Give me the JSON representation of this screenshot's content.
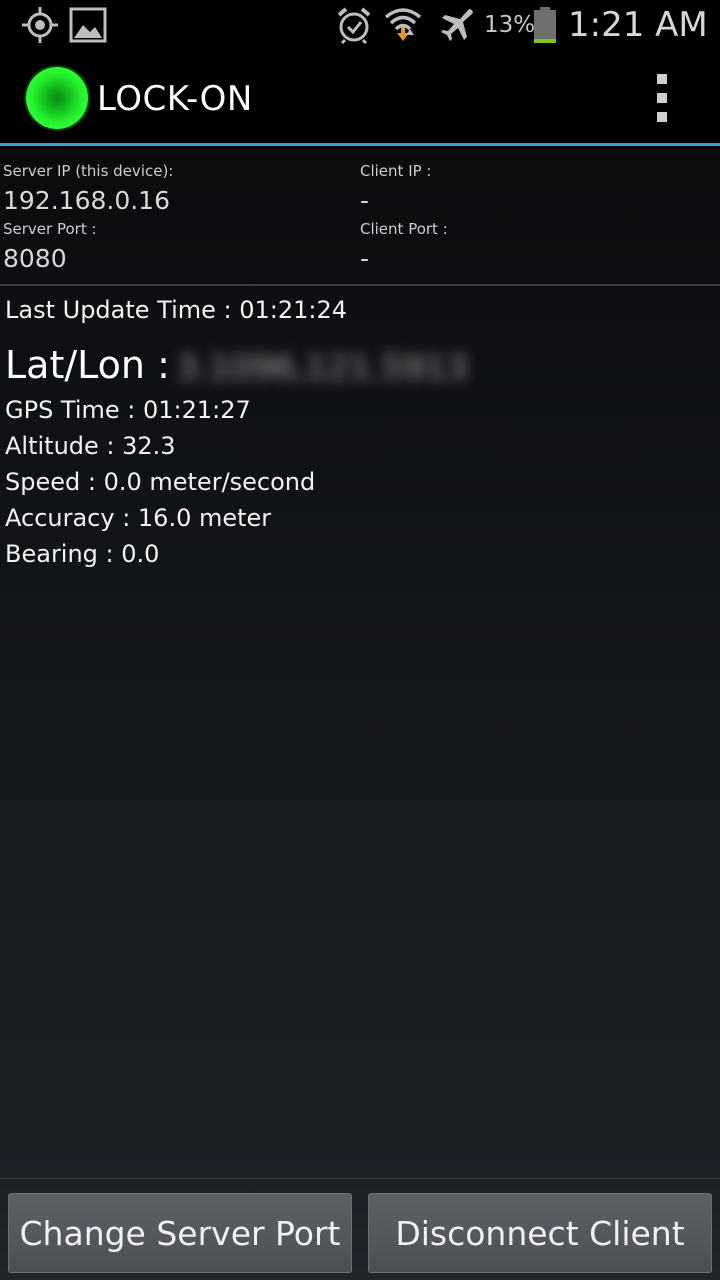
{
  "status_bar": {
    "icons": {
      "gps": "gps-icon",
      "image": "image-icon",
      "alarm": "alarm-icon",
      "wifi": "wifi-icon",
      "airplane": "airplane-icon",
      "battery": "battery-icon"
    },
    "battery_percent": "13%",
    "battery_level": 0.13,
    "time": "1:21 AM"
  },
  "action_bar": {
    "title": "LOCK-ON",
    "logo": "green-orb-logo",
    "menu_icon": "overflow-menu-icon"
  },
  "connection": {
    "server_ip_label": "Server IP (this device):",
    "server_ip": "192.168.0.16",
    "server_port_label": "Server Port :",
    "server_port": "8080",
    "client_ip_label": "Client IP :",
    "client_ip": "-",
    "client_port_label": "Client Port :",
    "client_port": "-"
  },
  "details": {
    "last_update": "Last Update Time : 01:21:24",
    "latlon_label": "Lat/Lon :",
    "latlon_value": "3.1096,121.5913",
    "gps_time": "GPS Time : 01:21:27",
    "altitude": "Altitude : 32.3",
    "speed": "Speed : 0.0 meter/second",
    "accuracy": "Accuracy : 16.0 meter",
    "bearing": "Bearing : 0.0"
  },
  "buttons": {
    "change_port": "Change Server Port",
    "disconnect": "Disconnect Client"
  },
  "colors": {
    "accent": "#33a3d6",
    "logo_green": "#2bff34",
    "battery_green": "#7ec81f"
  }
}
